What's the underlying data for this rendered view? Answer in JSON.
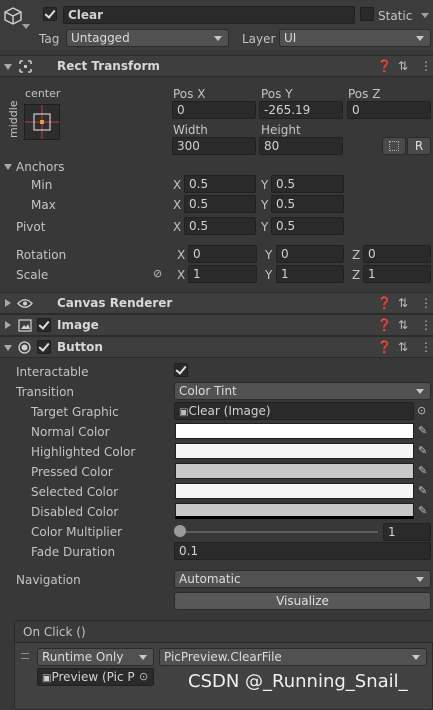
{
  "gameobject": {
    "active": true,
    "name": "Clear",
    "static_label": "Static",
    "tag_label": "Tag",
    "tag_value": "Untagged",
    "layer_label": "Layer",
    "layer_value": "UI"
  },
  "rect_transform": {
    "title": "Rect Transform",
    "anchor_preset_top": "center",
    "anchor_preset_side": "middle",
    "col_labels": [
      "Pos X",
      "Pos Y",
      "Pos Z"
    ],
    "pos": [
      "0",
      "-265.19",
      "0"
    ],
    "size_labels": [
      "Width",
      "Height"
    ],
    "size": [
      "300",
      "80"
    ],
    "r_button": "R",
    "anchors_label": "Anchors",
    "min_label": "Min",
    "min": [
      "0.5",
      "0.5"
    ],
    "max_label": "Max",
    "max": [
      "0.5",
      "0.5"
    ],
    "pivot_label": "Pivot",
    "pivot": [
      "0.5",
      "0.5"
    ],
    "rotation_label": "Rotation",
    "rotation": [
      "0",
      "0",
      "0"
    ],
    "scale_label": "Scale",
    "scale": [
      "1",
      "1",
      "1"
    ],
    "axes": [
      "X",
      "Y",
      "Z"
    ]
  },
  "canvas_renderer": {
    "title": "Canvas Renderer"
  },
  "image": {
    "title": "Image",
    "enabled": true
  },
  "button": {
    "title": "Button",
    "enabled": true,
    "interactable_label": "Interactable",
    "interactable": true,
    "transition_label": "Transition",
    "transition_value": "Color Tint",
    "target_graphic_label": "Target Graphic",
    "target_graphic_value": "Clear (Image)",
    "normal_label": "Normal Color",
    "normal_color": "#ffffff",
    "highlighted_label": "Highlighted Color",
    "highlighted_color": "#f5f5f5",
    "pressed_label": "Pressed Color",
    "pressed_color": "#c8c8c8",
    "selected_label": "Selected Color",
    "selected_color": "#f5f5f5",
    "disabled_label": "Disabled Color",
    "disabled_color": "#c8c8c8",
    "multiplier_label": "Color Multiplier",
    "multiplier_value": "1",
    "multiplier_fraction": 0.0,
    "fade_label": "Fade Duration",
    "fade_value": "0.1",
    "navigation_label": "Navigation",
    "navigation_value": "Automatic",
    "visualize_label": "Visualize"
  },
  "onclick": {
    "title": "On Click ()",
    "runtime": "Runtime Only",
    "function": "PicPreview.ClearFile",
    "object": "Preview (Pic P"
  },
  "watermark": "CSDN @_Running_Snail_"
}
